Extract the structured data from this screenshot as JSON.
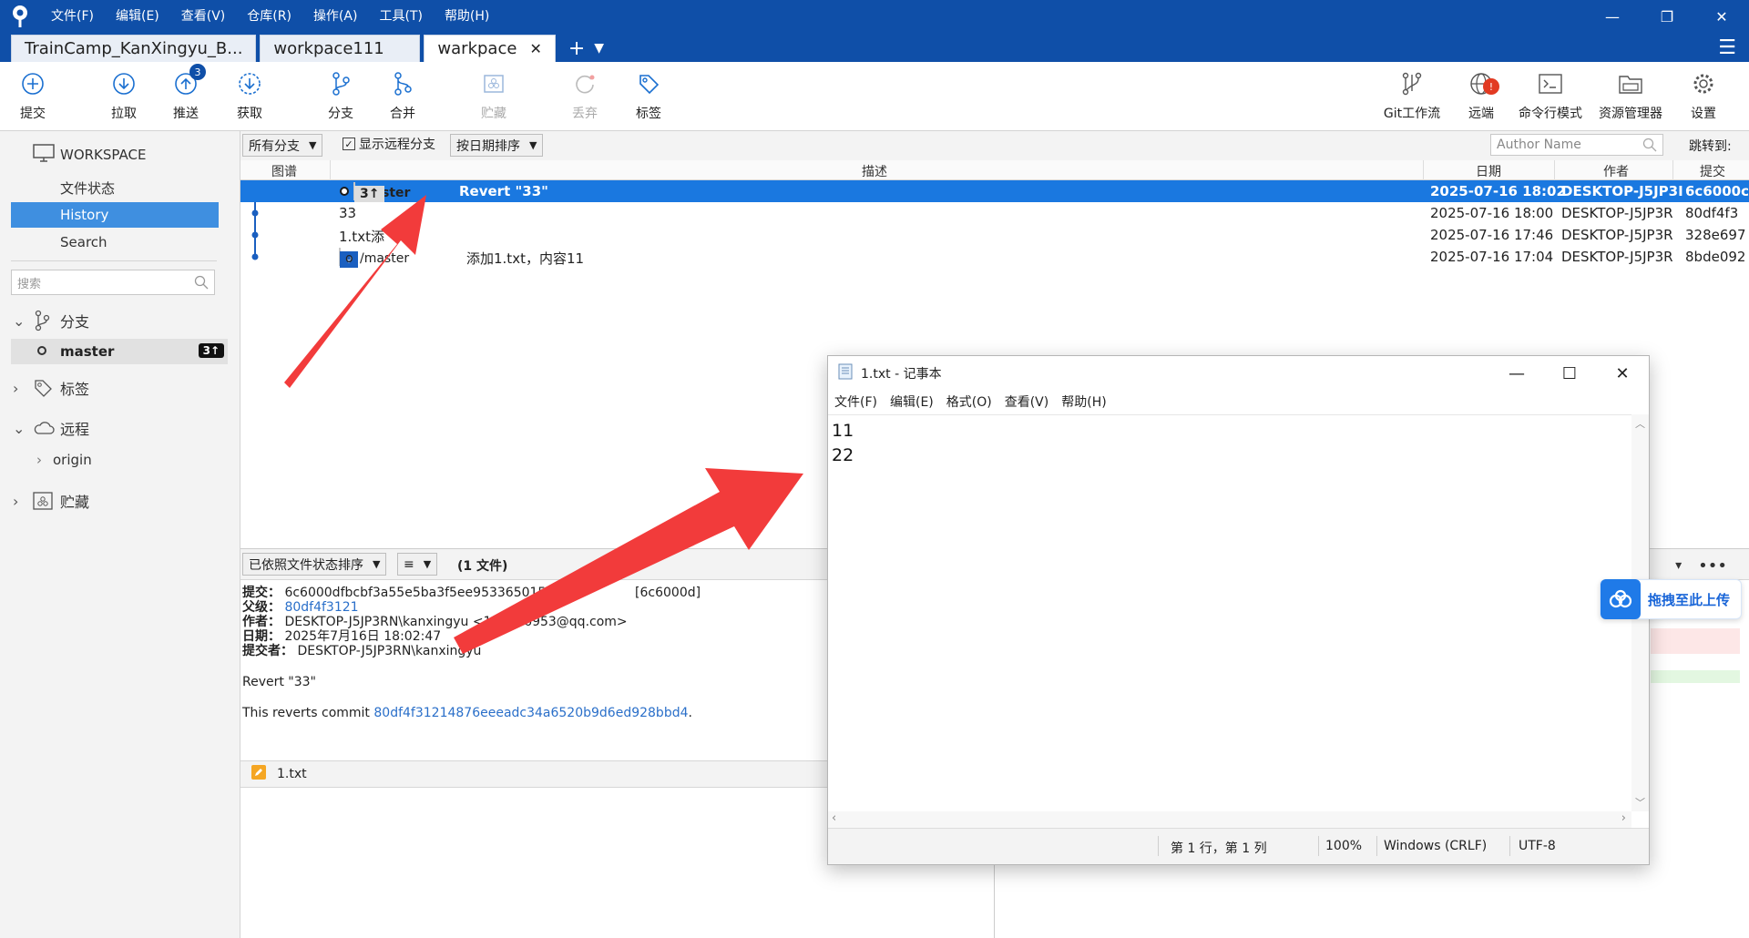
{
  "titlebar": {
    "menu": [
      "文件(F)",
      "编辑(E)",
      "查看(V)",
      "仓库(R)",
      "操作(A)",
      "工具(T)",
      "帮助(H)"
    ]
  },
  "tabs": [
    {
      "label": "TrainCamp_KanXingyu_B...",
      "active": false
    },
    {
      "label": "workpace111",
      "active": false
    },
    {
      "label": "warkpace",
      "active": true
    }
  ],
  "toolbar": {
    "commit": "提交",
    "pull": "拉取",
    "push": "推送",
    "push_badge": "3",
    "fetch": "获取",
    "branch": "分支",
    "merge": "合并",
    "stash": "贮藏",
    "discard": "丢弃",
    "tag": "标签",
    "gitflow": "Git工作流",
    "remote": "远端",
    "remote_badge": "!",
    "terminal": "命令行模式",
    "explorer": "资源管理器",
    "settings": "设置"
  },
  "sidebar": {
    "workspace": "WORKSPACE",
    "file_status": "文件状态",
    "history": "History",
    "search_item": "Search",
    "search_placeholder": "搜索",
    "branches": "分支",
    "branch_master": "master",
    "branch_master_ahead": "3↑",
    "tags": "标签",
    "remotes": "远程",
    "remote_origin": "origin",
    "stashes": "贮藏"
  },
  "filter": {
    "branches": "所有分支",
    "show_remote": "显示远程分支",
    "sort": "按日期排序",
    "author_placeholder": "Author Name",
    "jump": "跳转到:"
  },
  "columns": {
    "graph": "图谱",
    "desc": "描述",
    "date": "日期",
    "author": "作者",
    "commit": "提交"
  },
  "commits": [
    {
      "tag_branch": "master",
      "tag_count": "3↑",
      "desc": "Revert \"33\"",
      "date": "2025-07-16 18:02",
      "author": "DESKTOP-J5JP3I",
      "hash": "6c6000c"
    },
    {
      "desc": "33",
      "date": "2025-07-16 18:00",
      "author": "DESKTOP-J5JP3R",
      "hash": "80df4f3"
    },
    {
      "desc": "1.txt添",
      "date": "2025-07-16 17:46",
      "author": "DESKTOP-J5JP3R",
      "hash": "328e697"
    },
    {
      "tag_prefix": "o",
      "tag_branch": "/master",
      "desc": "添加1.txt，内容11",
      "date": "2025-07-16 17:04",
      "author": "DESKTOP-J5JP3R",
      "hash": "8bde092"
    }
  ],
  "details": {
    "sort_files": "已依照文件状态排序",
    "list_mode": "≡",
    "file_count": "(1 文件)",
    "commit_label": "提交：",
    "commit_value": "6c6000dfbcbf3a55e5ba3f5ee953365015c",
    "commit_short": "[6c6000d]",
    "parent_label": "父级：",
    "parent_value": "80df4f3121",
    "author_label": "作者：",
    "author_value": "DESKTOP-J5JP3RN\\kanxingyu <1",
    "author_email": "04726953@qq.com>",
    "date_label": "日期：",
    "date_value": "2025年7月16日 18:02:47",
    "committer_label": "提交者：",
    "committer_value": "DESKTOP-J5JP3RN\\kanxingyu",
    "message": "Revert \"33\"",
    "reverts_prefix": "This reverts commit ",
    "reverts_hash": "80df4f31214876eeeadc34a6520b9d6ed928bbd4",
    "reverts_suffix": ".",
    "file_name": "1.txt"
  },
  "notepad": {
    "title": "1.txt - 记事本",
    "menu": [
      "文件(F)",
      "编辑(E)",
      "格式(O)",
      "查看(V)",
      "帮助(H)"
    ],
    "line1": "11",
    "line2": "22",
    "status_pos": "第 1 行，第 1 列",
    "status_zoom": "100%",
    "status_eol": "Windows (CRLF)",
    "status_enc": "UTF-8"
  },
  "upload": {
    "label": "拖拽至此上传"
  },
  "colors": {
    "brand": "#0f4fa8",
    "selection": "#1a78e0",
    "sidebar_sel": "#3f8fe0",
    "arrow": "#f23b3b"
  }
}
